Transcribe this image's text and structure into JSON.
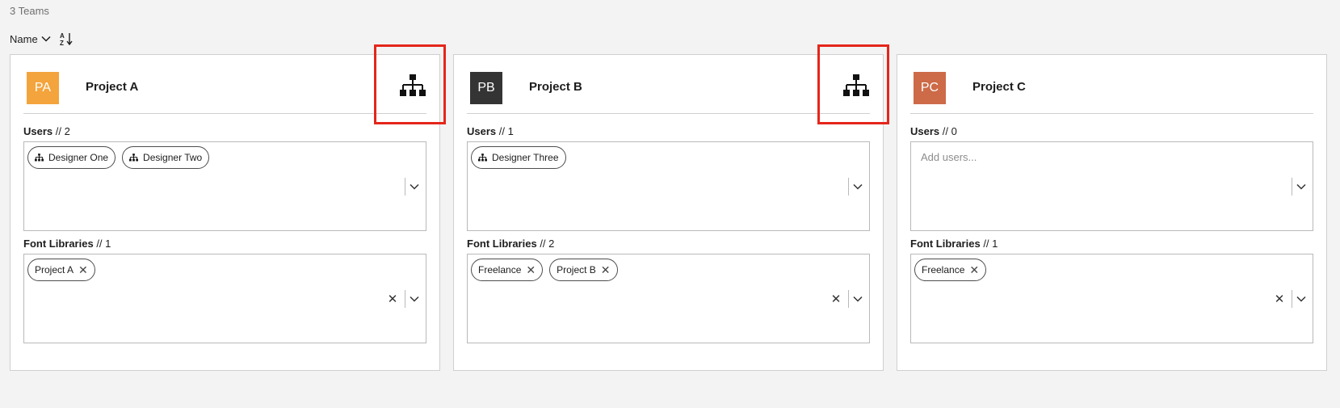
{
  "header": {
    "team_count": "3 Teams",
    "sort_label": "Name"
  },
  "labels": {
    "users": "Users",
    "font_libraries": "Font Libraries",
    "separator": "//"
  },
  "teams": [
    {
      "initials": "PA",
      "name": "Project A",
      "avatar_color": "#f4a43c",
      "has_hierarchy": true,
      "users_count": "2",
      "users": [
        "Designer One",
        "Designer Two"
      ],
      "users_placeholder": "",
      "libraries_count": "1",
      "libraries": [
        "Project A"
      ]
    },
    {
      "initials": "PB",
      "name": "Project B",
      "avatar_color": "#343434",
      "has_hierarchy": true,
      "users_count": "1",
      "users": [
        "Designer Three"
      ],
      "users_placeholder": "",
      "libraries_count": "2",
      "libraries": [
        "Freelance",
        "Project B"
      ]
    },
    {
      "initials": "PC",
      "name": "Project C",
      "avatar_color": "#cd6a47",
      "has_hierarchy": false,
      "users_count": "0",
      "users": [],
      "users_placeholder": "Add users...",
      "libraries_count": "1",
      "libraries": [
        "Freelance"
      ]
    }
  ],
  "colors": {
    "highlight": "#e5261b",
    "background": "#f3f3f3"
  }
}
